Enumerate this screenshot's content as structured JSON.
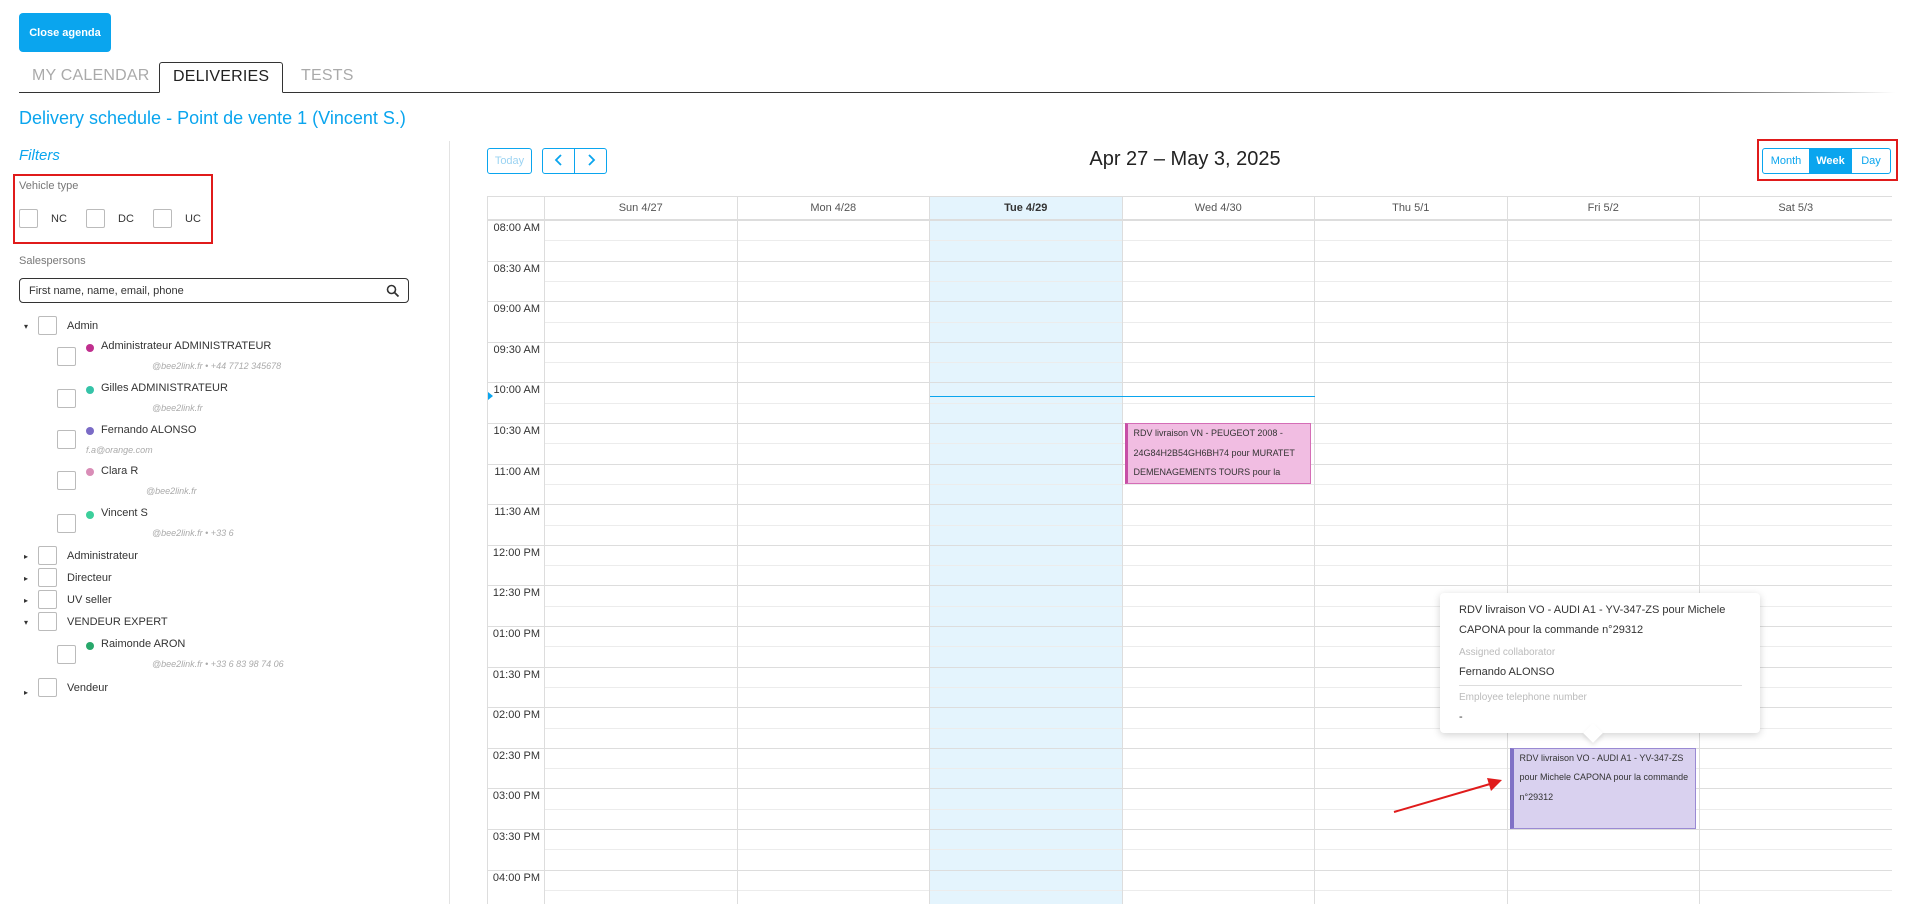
{
  "header": {
    "close_label": "Close agenda"
  },
  "tabs": [
    {
      "label": "MY CALENDAR"
    },
    {
      "label": "DELIVERIES"
    },
    {
      "label": "TESTS"
    }
  ],
  "page_title": "Delivery schedule - Point de vente 1 (Vincent S.)",
  "filters": {
    "title": "Filters",
    "vehicle_type_label": "Vehicle type",
    "vehicle_types": [
      "NC",
      "DC",
      "UC"
    ],
    "salespersons_label": "Salespersons",
    "search_placeholder": "First name, name, email, phone"
  },
  "tree": {
    "admin": {
      "label": "Admin",
      "people": [
        {
          "name": "Administrateur ADMINISTRATEUR",
          "info": "@bee2link.fr  •  +44 7712 345678",
          "color": "#c02f8e"
        },
        {
          "name": "Gilles ADMINISTRATEUR",
          "info": "@bee2link.fr",
          "color": "#35c3a8"
        },
        {
          "name": "Fernando ALONSO",
          "info": "f.a@orange.com",
          "color": "#7a6bc6"
        },
        {
          "name": "Clara R",
          "info": "@bee2link.fr",
          "color": "#d98db7"
        },
        {
          "name": "Vincent S",
          "info": "@bee2link.fr  •  +33 6",
          "color": "#3ccf9b"
        }
      ]
    },
    "administrateur": {
      "label": "Administrateur"
    },
    "directeur": {
      "label": "Directeur"
    },
    "uv_seller": {
      "label": "UV seller"
    },
    "vendeur_expert": {
      "label": "VENDEUR EXPERT",
      "people": [
        {
          "name": "Raimonde ARON",
          "info": "@bee2link.fr  •  +33 6 83 98 74 06",
          "color": "#28a86b"
        }
      ]
    },
    "vendeur": {
      "label": "Vendeur"
    }
  },
  "toolbar": {
    "today_label": "Today",
    "prev_icon": "chevron-left-icon",
    "next_icon": "chevron-right-icon",
    "range_title": "Apr 27 – May 3, 2025",
    "views": [
      "Month",
      "Week",
      "Day"
    ],
    "active_view": "Week"
  },
  "calendar": {
    "days": [
      "Sun 4/27",
      "Mon 4/28",
      "Tue 4/29",
      "Wed 4/30",
      "Thu 5/1",
      "Fri 5/2",
      "Sat 5/3"
    ],
    "today_index": 2,
    "times": [
      "08:00 AM",
      "08:30 AM",
      "09:00 AM",
      "09:30 AM",
      "10:00 AM",
      "10:30 AM",
      "11:00 AM",
      "11:30 AM",
      "12:00 PM",
      "12:30 PM",
      "01:00 PM",
      "01:30 PM",
      "02:00 PM",
      "02:30 PM",
      "03:00 PM",
      "03:30 PM",
      "04:00 PM"
    ],
    "events": [
      {
        "text": "RDV livraison VN - PEUGEOT 2008 - 24G84H2B54GH6BH74 pour MURATET DEMENAGEMENTS TOURS pour la",
        "day": 3,
        "start": "10:30 AM",
        "end": "11:15 AM",
        "color": "#c74fa6"
      },
      {
        "text": "RDV livraison VO - AUDI A1 - YV-347-ZS pour Michele CAPONA pour la commande n°29312",
        "day": 5,
        "start": "02:30 PM",
        "end": "03:30 PM",
        "color": "#8071c6"
      }
    ]
  },
  "popup": {
    "title": "RDV livraison VO - AUDI A1 - YV-347-ZS pour Michele CAPONA pour la commande n°29312",
    "collab_label": "Assigned collaborator",
    "collab_value": "Fernando ALONSO",
    "phone_label": "Employee telephone number",
    "phone_value": "-"
  }
}
